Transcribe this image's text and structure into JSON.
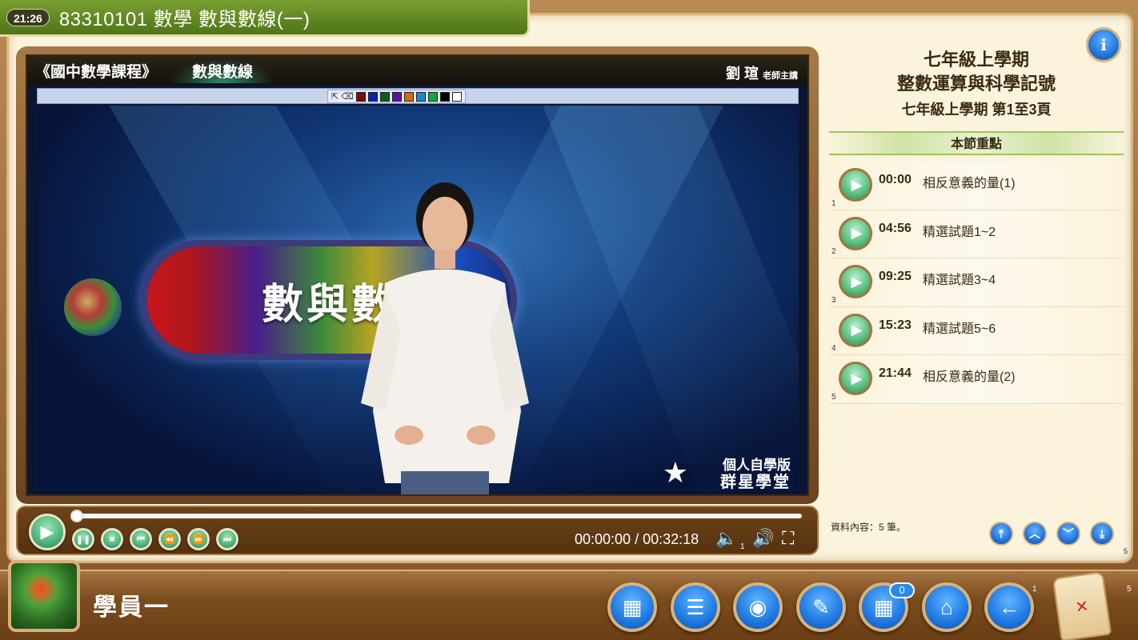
{
  "header": {
    "clock": "21:26",
    "title": "83310101 數學 數與數線(一)"
  },
  "video": {
    "course_name": "《國中數學課程》",
    "lesson_tab": "數與數線",
    "teacher_name": "劉 瑄",
    "teacher_suffix": "老師主講",
    "capsule_text": "數與數",
    "brand_line1": "個人自學版",
    "brand_line2": "群星學堂",
    "pen_colors": [
      "#7a0a0a",
      "#0b1fb5",
      "#0b5e1a",
      "#5a12a8",
      "#d26a10",
      "#1d86d8",
      "#1aa53a",
      "#000000",
      "#ffffff"
    ],
    "pen_tools": [
      "pointer-icon",
      "eraser-icon"
    ]
  },
  "player": {
    "play_progress": 0.0,
    "time": "00:00:00 / 00:32:18",
    "volume_level": "1",
    "controls": [
      "pause-icon",
      "stop-icon",
      "skip-start-icon",
      "rewind-icon",
      "fast-forward-icon",
      "skip-end-icon"
    ]
  },
  "info": {
    "label": "i"
  },
  "sidebar": {
    "title1": "七年級上學期",
    "title2": "整數運算與科學記號",
    "title3": "七年級上學期 第1至3頁",
    "section_header": "本節重點",
    "chapters": [
      {
        "index": "1",
        "time": "00:00",
        "title": "相反意義的量(1)"
      },
      {
        "index": "2",
        "time": "04:56",
        "title": "精選試題1~2"
      },
      {
        "index": "3",
        "time": "09:25",
        "title": "精選試題3~4"
      },
      {
        "index": "4",
        "time": "15:23",
        "title": "精選試題5~6"
      },
      {
        "index": "5",
        "time": "21:44",
        "title": "相反意義的量(2)"
      }
    ],
    "record_count": "資料內容：5 筆。",
    "page_indicator": "5"
  },
  "bottom": {
    "user_name": "學員一",
    "message_count": "0",
    "tiny_left": "1",
    "tiny_right": "5",
    "buttons": [
      "playlist-grid-icon",
      "playlist-icon",
      "camera-icon",
      "pencil-icon",
      "keypad-icon",
      "home-icon",
      "back-arrow-icon"
    ]
  }
}
